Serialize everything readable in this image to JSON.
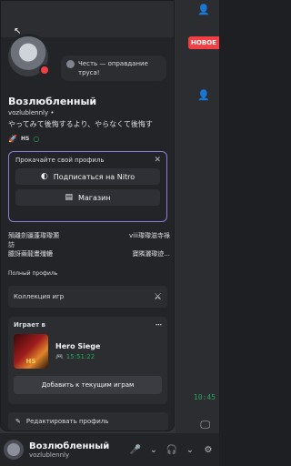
{
  "background": {
    "badge": "НОВОЕ",
    "timestamp": "10:45"
  },
  "profile": {
    "status_text": "Честь — оправдание труса!",
    "display_name": "Возлюбленный",
    "username": "vozlublennly",
    "username_suffix": "•",
    "bio": "やってみて後悔するより、やらなくて後悔す",
    "badge_label": "HS"
  },
  "nitro": {
    "title": "Прокачайте свой профиль",
    "subscribe_label": "Подписаться на Nitro",
    "shop_label": "Магазин"
  },
  "cjk_text": {
    "row1_left": "殞離劍疆蓬瓈瓈灝",
    "row1_right": "viii瓈瓈滋寺祿",
    "row2_left": "訪",
    "row3_left": "臘訝繭龍畫殲轆",
    "row3_right": "寶隣灑瓈迹..."
  },
  "sections": {
    "full_profile": "Полный профиль",
    "collection": "Коллекция игр",
    "playing_in": "Играет в",
    "add_current": "Добавить к текущим играм",
    "edit_profile": "Редактировать профиль"
  },
  "game": {
    "name": "Hero Siege",
    "elapsed": "15:51:22"
  },
  "user_bar": {
    "display_name": "Возлюбленный",
    "username": "vozlublennly"
  },
  "colors": {
    "accent": "#8f7bd8",
    "status_dnd": "#f23f43",
    "playing_green": "#23a55a"
  }
}
